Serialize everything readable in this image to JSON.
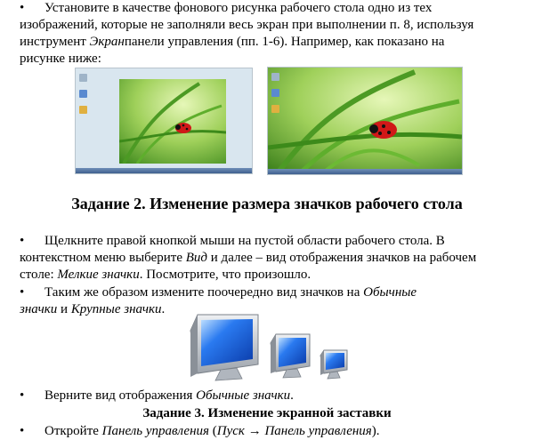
{
  "para1": {
    "bullet": "•",
    "line1": "Установите в качестве фонового рисунка рабочего стола одно из тех",
    "line2": "изображений, которые не заполняли весь экран при выполнении п. 8, используя",
    "line3_a": "инструмент ",
    "line3_em": "Экран",
    "line3_b": "панели управления (пп. 1-6). Например, как показано на",
    "line4": "рисунке ниже:"
  },
  "heading2": "Задание 2. Изменение размера значков рабочего стола",
  "para2": {
    "bullet": "•",
    "line1": "Щелкните правой кнопкой мыши на пустой области рабочего стола. В",
    "line2_a": "контекстном меню выберите ",
    "line2_em": "Вид",
    "line2_b": " и далее – вид отображения значков на рабочем",
    "line3_a": "столе: ",
    "line3_em": "Мелкие значки",
    "line3_b": ". Посмотрите, что произошло."
  },
  "para3": {
    "bullet": "•",
    "line1_a": "Таким же образом измените поочередно вид значков на ",
    "line1_em": "Обычные",
    "line2_em1": "значки",
    "line2_mid": " и ",
    "line2_em2": "Крупные значки",
    "line2_end": "."
  },
  "para4": {
    "bullet": "•",
    "text_a": "Верните вид отображения ",
    "text_em": "Обычные значки",
    "text_b": "."
  },
  "heading3": "Задание 3. Изменение экранной заставки",
  "para5": {
    "bullet": "•",
    "text_a": "Откройте ",
    "text_em1": "Панель управления",
    "text_mid": " (",
    "text_em2": "Пуск",
    "text_arrow": " → ",
    "text_em3": "Панель управления",
    "text_end": ")."
  },
  "colors": {
    "wallpaper_green": "#7cc043",
    "wallpaper_light": "#d8f0a8",
    "ladybug": "#d01818",
    "monitor_blue": "#1a5fd8",
    "monitor_frame": "#c8ccd2"
  }
}
